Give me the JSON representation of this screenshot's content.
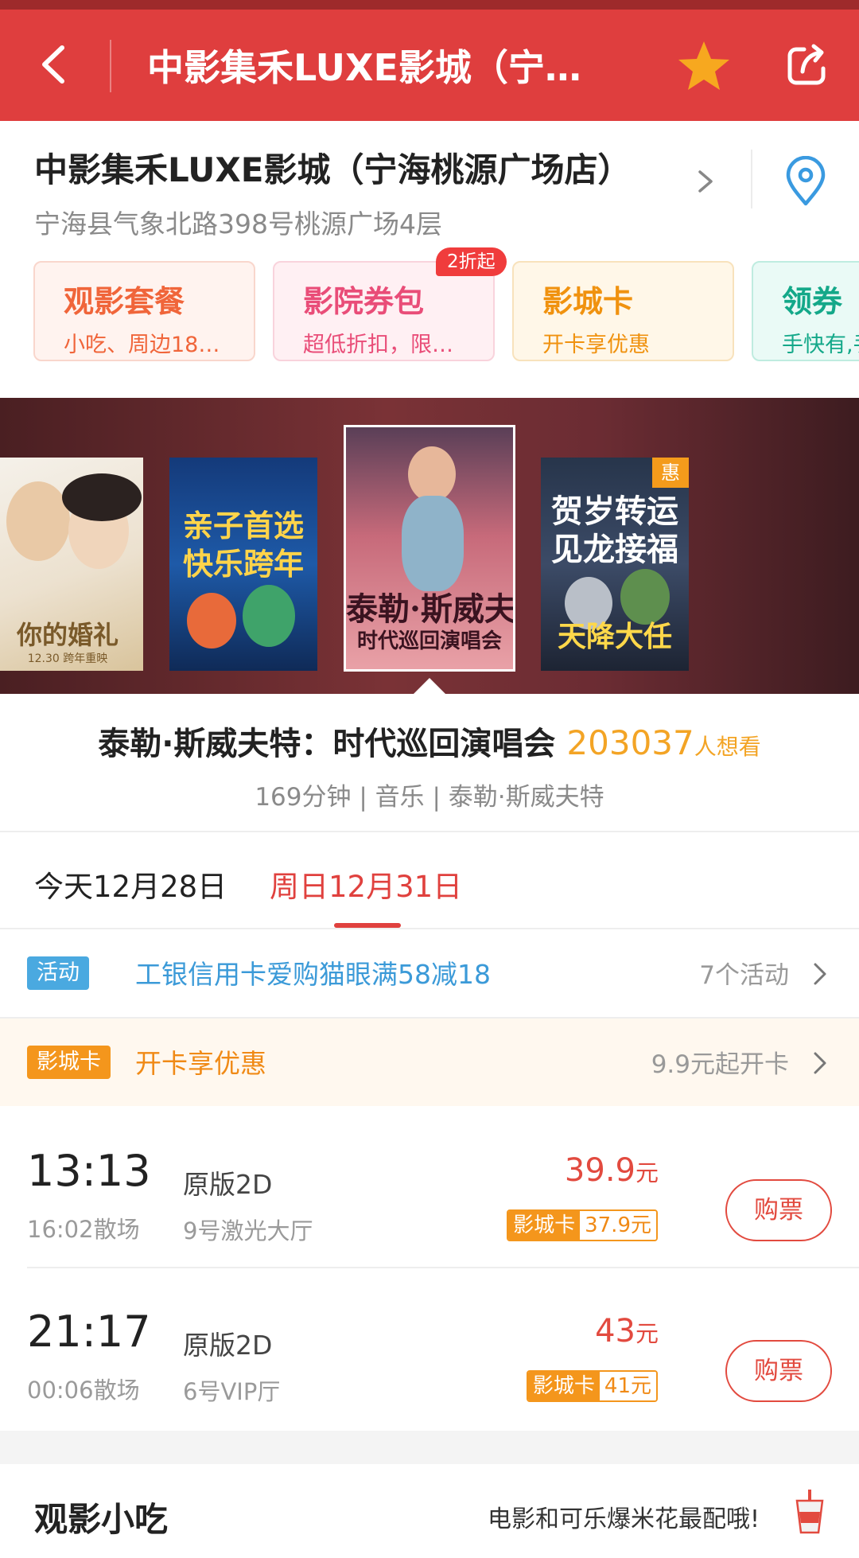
{
  "header": {
    "title": "中影集禾LUXE影城（宁…",
    "icons": [
      "back-icon",
      "star-icon",
      "share-icon"
    ],
    "colors": {
      "bar": "#df3e3e",
      "star": "#f7a81f"
    }
  },
  "cinema": {
    "name": "中影集禾LUXE影城（宁海桃源广场店）",
    "address": "宁海县气象北路398号桃源广场4层"
  },
  "services": [
    {
      "title": "观影套餐",
      "subtitle": "小吃、周边18…"
    },
    {
      "title": "影院券包",
      "subtitle": "超低折扣，限…",
      "badge": "2折起"
    },
    {
      "title": "影城卡",
      "subtitle": "开卡享优惠"
    },
    {
      "title": "领券",
      "subtitle": "手快有,手…"
    }
  ],
  "posters": {
    "p1": {
      "title": "你的婚礼",
      "date": "12.30 跨年重映"
    },
    "p2": {
      "title": "亲子首选 快乐跨年"
    },
    "p3": {
      "title": "泰勒·斯威夫特",
      "subtitle": "时代巡回演唱会"
    },
    "p4": {
      "title": "贺岁转运 见龙接福",
      "subtitle": "天降大任",
      "badge": "惠"
    }
  },
  "movie": {
    "title": "泰勒·斯威夫特：时代巡回演唱会",
    "want_count": "203037",
    "want_label": "人想看",
    "meta": "169分钟 | 音乐 | 泰勒·斯威夫特"
  },
  "dates": {
    "tabs": [
      "今天12月28日",
      "周日12月31日"
    ],
    "selected_index": 1
  },
  "activity": {
    "tag": "活动",
    "text": "工银信用卡爱购猫眼满58减18",
    "right": "7个活动"
  },
  "card_row": {
    "tag": "影城卡",
    "text": "开卡享优惠",
    "right": "9.9元起开卡"
  },
  "showtimes": [
    {
      "start": "13:13",
      "end": "16:02散场",
      "version": "原版2D",
      "hall": "9号激光大厅",
      "price": "39.9",
      "price_unit": "元",
      "card_label": "影城卡",
      "card_price": "37.9元",
      "buy": "购票"
    },
    {
      "start": "21:17",
      "end": "00:06散场",
      "version": "原版2D",
      "hall": "6号VIP厅",
      "price": "43",
      "price_unit": "元",
      "card_label": "影城卡",
      "card_price": "41元",
      "buy": "购票"
    }
  ],
  "snacks": {
    "title": "观影小吃",
    "subtitle": "电影和可乐爆米花最配哦!"
  }
}
